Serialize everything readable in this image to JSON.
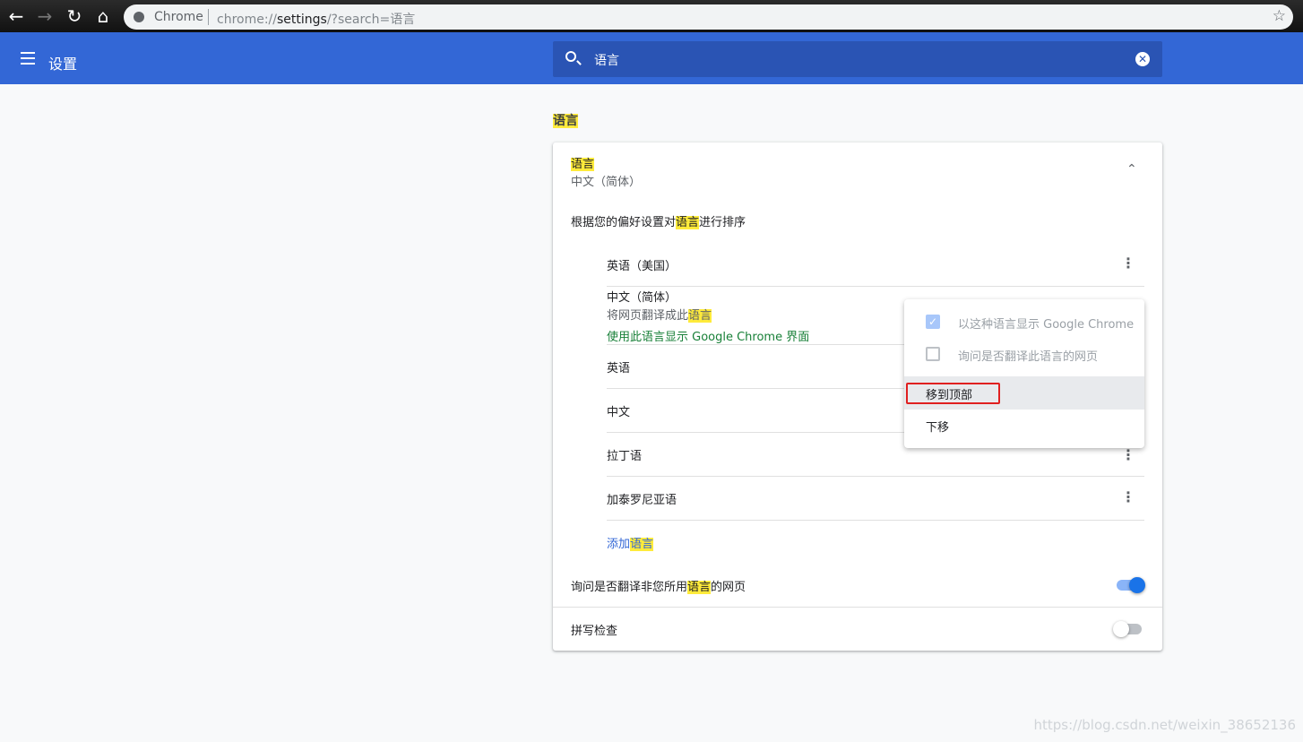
{
  "browser": {
    "site_label": "Chrome",
    "url_prefix": "chrome://",
    "url_host": "settings",
    "url_rest": "/?search=语言",
    "icons": [
      "back-icon",
      "forward-icon",
      "reload-icon",
      "home-icon",
      "star-icon"
    ]
  },
  "header": {
    "title": "设置",
    "search_value": "语言"
  },
  "section_title": "语言",
  "card": {
    "title": "语言",
    "subtitle": "中文（简体）",
    "desc": {
      "pre": "根据您的偏好设置对",
      "hl": "语言",
      "post": "进行排序"
    },
    "languages": [
      {
        "name": "英语（美国）"
      },
      {
        "name": "中文（简体）",
        "line2": {
          "pre": "将网页翻译成此",
          "hl": "语言"
        },
        "line3": "使用此语言显示 Google Chrome 界面"
      },
      {
        "name": "英语"
      },
      {
        "name": "中文"
      },
      {
        "name": "拉丁语"
      },
      {
        "name": "加泰罗尼亚语"
      }
    ],
    "add": {
      "pre": "添加",
      "hl": "语言"
    },
    "translate_toggle": {
      "pre": "询问是否翻译非您所用",
      "hl": "语言",
      "post": "的网页",
      "on": true
    },
    "spellcheck": {
      "label": "拼写检查",
      "on": false
    }
  },
  "menu": {
    "check1": {
      "label": "以这种语言显示 Google Chrome",
      "checked": true,
      "disabled": true
    },
    "check2": {
      "label": "询问是否翻译此语言的网页",
      "checked": false,
      "disabled": true
    },
    "items": [
      "移到顶部",
      "下移"
    ]
  },
  "watermark": "https://blog.csdn.net/weixin_38652136",
  "colors": {
    "header": "#3367d6",
    "accent": "#1a73e8",
    "highlight": "#ffeb3b",
    "annotation": "#e02020",
    "green_text": "#188038"
  }
}
